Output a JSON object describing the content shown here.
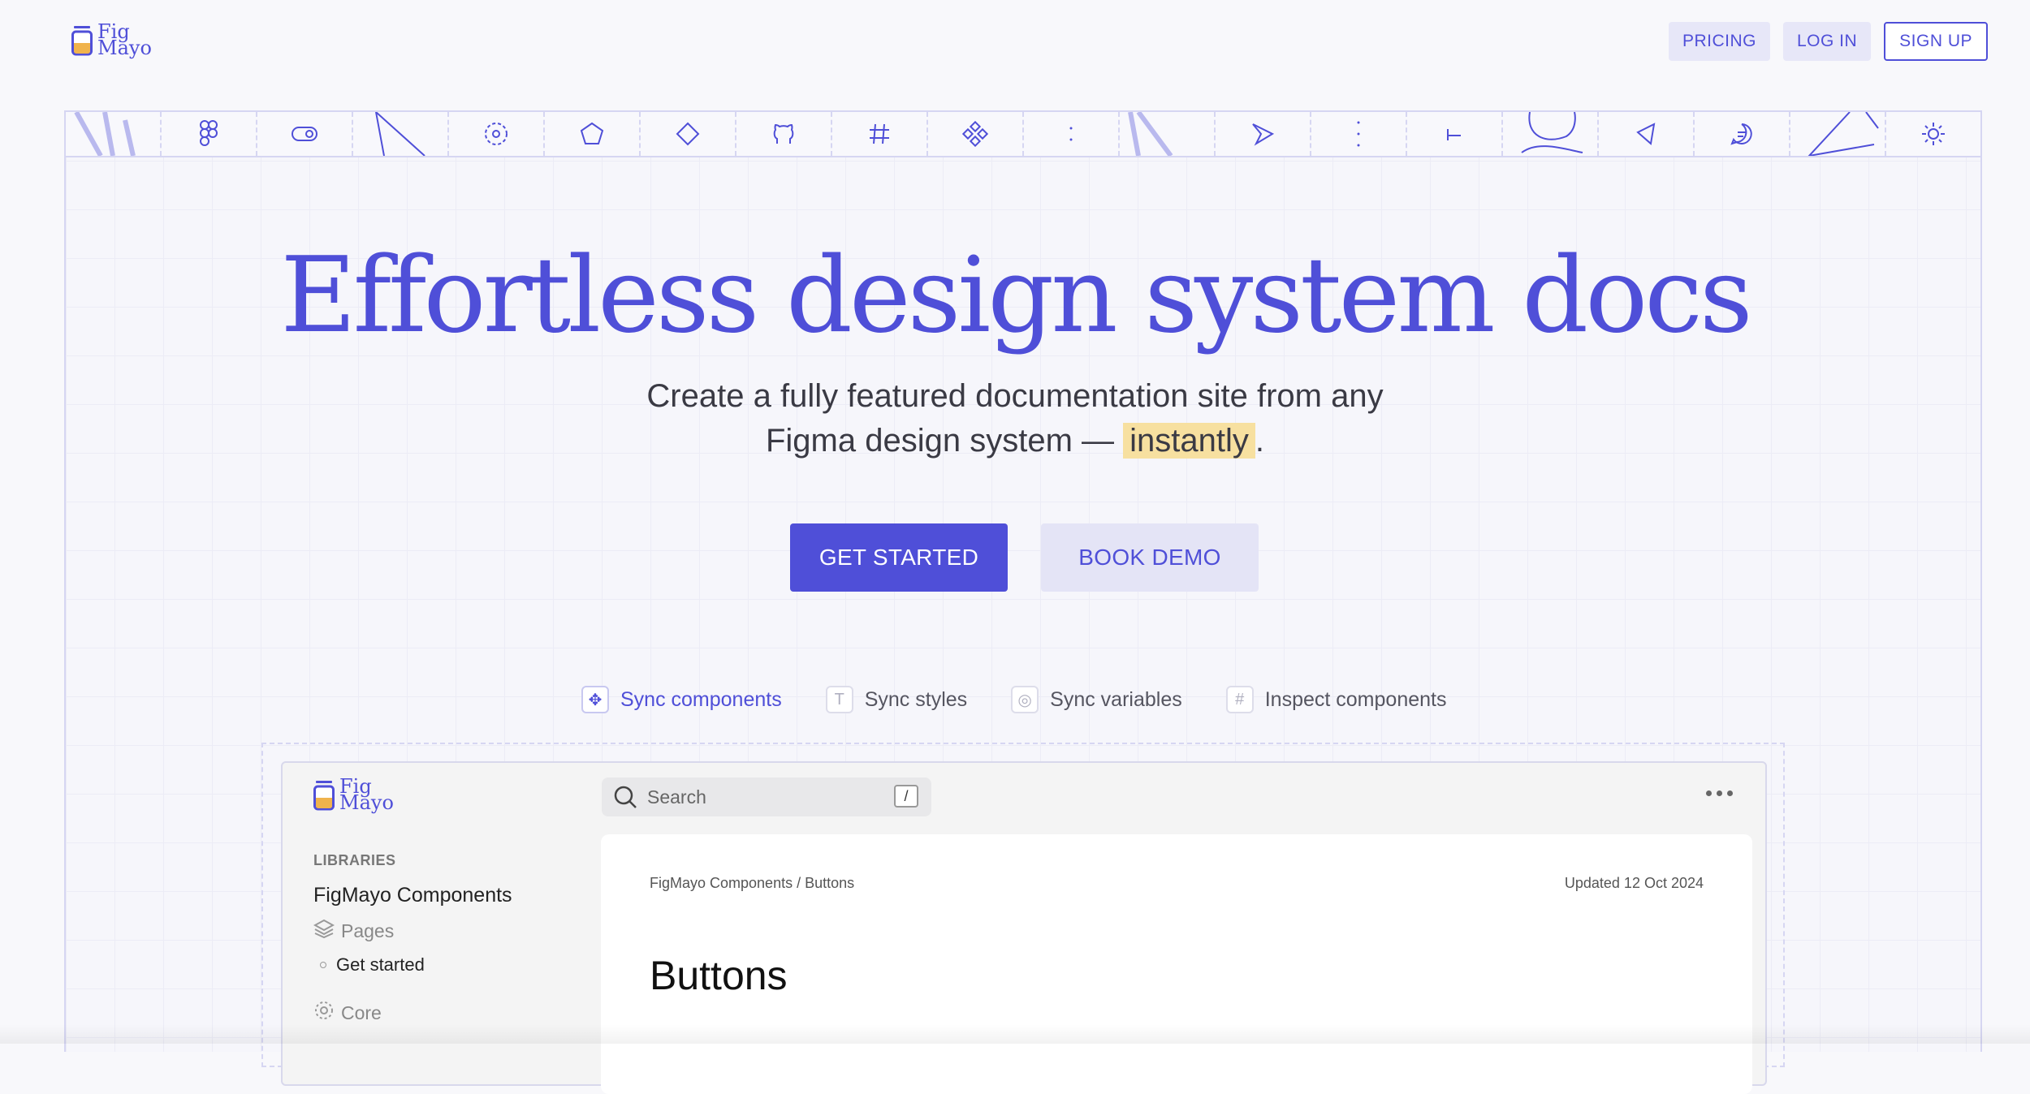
{
  "header": {
    "logo_line1": "Fig",
    "logo_line2": "Mayo",
    "nav": {
      "pricing": "PRICING",
      "login": "LOG IN",
      "signup": "SIGN UP"
    }
  },
  "hero": {
    "title": "Effortless design system docs",
    "subtitle_line1": "Create a fully featured documentation site from any",
    "subtitle_line2_prefix": "Figma design system — ",
    "subtitle_highlight": "instantly",
    "subtitle_suffix": ".",
    "cta_primary": "GET STARTED",
    "cta_secondary": "BOOK DEMO"
  },
  "tabs": [
    {
      "label": "Sync components",
      "icon": "component-icon",
      "active": true
    },
    {
      "label": "Sync styles",
      "icon": "text-style-icon",
      "active": false
    },
    {
      "label": "Sync variables",
      "icon": "variable-icon",
      "active": false
    },
    {
      "label": "Inspect components",
      "icon": "grid-hash-icon",
      "active": false
    }
  ],
  "preview": {
    "search_placeholder": "Search",
    "search_shortcut": "/",
    "sidebar": {
      "section_label": "LIBRARIES",
      "library_name": "FigMayo Components",
      "pages_label": "Pages",
      "page_item": "Get started",
      "core_label": "Core"
    },
    "doc": {
      "breadcrumb": "FigMayo Components / Buttons",
      "updated": "Updated 12 Oct 2024",
      "title": "Buttons"
    }
  },
  "colors": {
    "accent": "#4f4fd8",
    "accent_light": "#e7e7f8",
    "highlight": "#f7e0a0"
  }
}
